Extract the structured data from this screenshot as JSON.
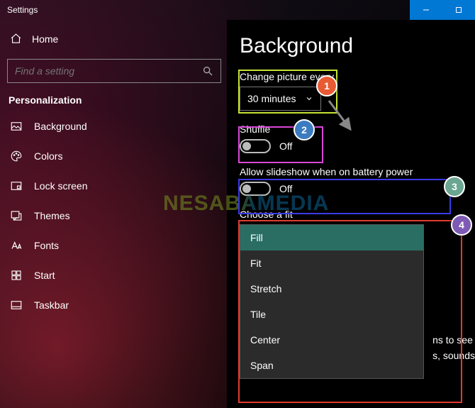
{
  "window": {
    "title": "Settings"
  },
  "sidebar": {
    "home": "Home",
    "search_placeholder": "Find a setting",
    "category": "Personalization",
    "items": [
      {
        "label": "Background",
        "icon": "image-icon"
      },
      {
        "label": "Colors",
        "icon": "palette-icon"
      },
      {
        "label": "Lock screen",
        "icon": "lockscreen-icon"
      },
      {
        "label": "Themes",
        "icon": "themes-icon"
      },
      {
        "label": "Fonts",
        "icon": "fonts-icon"
      },
      {
        "label": "Start",
        "icon": "start-icon"
      },
      {
        "label": "Taskbar",
        "icon": "taskbar-icon"
      }
    ]
  },
  "main": {
    "title": "Background",
    "change_every_label": "Change picture every",
    "change_every_value": "30 minutes",
    "shuffle_label": "Shuffle",
    "shuffle_value": "Off",
    "battery_label": "Allow slideshow when on battery power",
    "battery_value": "Off",
    "fit_label": "Choose a fit",
    "fit_options": [
      "Fill",
      "Fit",
      "Stretch",
      "Tile",
      "Center",
      "Span"
    ],
    "fit_selected": "Fill",
    "truncated_right_1": "ns to see",
    "truncated_right_2": "s, sounds"
  },
  "watermark": "NESABAMEDIA",
  "annotations": {
    "steps": [
      "1",
      "2",
      "3",
      "4"
    ],
    "colors": {
      "step1": "#e85a33",
      "step2": "#3b7bbf",
      "step3": "#6aa691",
      "step4": "#7e5ab5",
      "hl1": "#c6e232",
      "hl2": "#d847d8",
      "hl3": "#3a3ae8",
      "hl4": "#e23a2d"
    }
  }
}
